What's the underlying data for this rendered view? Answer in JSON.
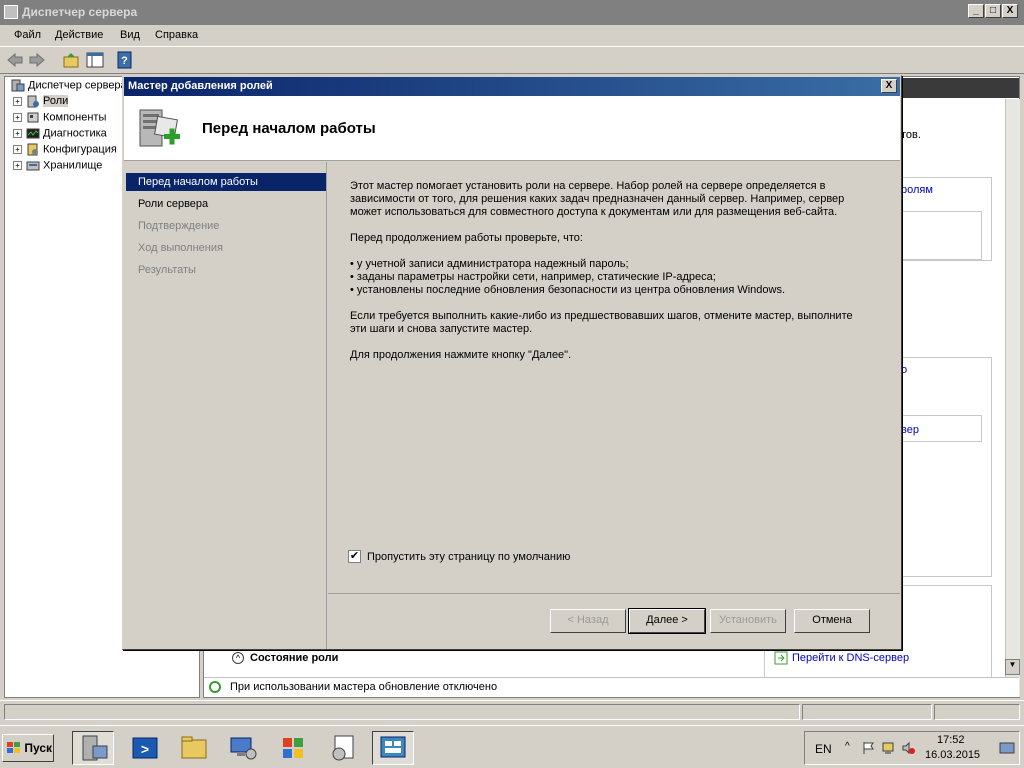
{
  "window": {
    "title": "Диспетчер сервера",
    "min": "_",
    "max": "□",
    "close": "X"
  },
  "menu": {
    "file": "Файл",
    "action": "Действие",
    "view": "Вид",
    "help": "Справка"
  },
  "tree": {
    "root": "Диспетчер сервера",
    "items": [
      "Роли",
      "Компоненты",
      "Диагностика",
      "Конфигурация",
      "Хранилище"
    ]
  },
  "background": {
    "frag1": "тов.",
    "frag2": "ролям",
    "frag3": "о",
    "frag4": "вер",
    "role_status": "Состояние роли",
    "dns_link": "Перейти к DNS-сервер",
    "status_text": "При использовании мастера обновление отключено"
  },
  "dialog": {
    "title": "Мастер добавления ролей",
    "heading": "Перед началом работы",
    "nav": [
      "Перед началом работы",
      "Роли сервера",
      "Подтверждение",
      "Ход выполнения",
      "Результаты"
    ],
    "para1": "Этот мастер помогает установить роли на сервере. Набор ролей на сервере определяется в зависимости от того, для решения каких задач предназначен данный сервер. Например, сервер может использоваться для совместного доступа к документам или для размещения веб-сайта.",
    "para2": "Перед продолжением работы проверьте, что:",
    "bullet1": "• у учетной записи администратора надежный пароль;",
    "bullet2": "• заданы параметры настройки сети, например, статические IP-адреса;",
    "bullet3": "• установлены последние обновления безопасности из центра обновления Windows.",
    "para3": "Если требуется выполнить какие-либо из предшествовавших шагов, отмените мастер, выполните эти шаги и снова запустите мастер.",
    "para4": "Для продолжения нажмите кнопку \"Далее\".",
    "skip_label": "Пропустить эту страницу по умолчанию",
    "skip_checked": "✔",
    "buttons": {
      "back": "< Назад",
      "next": "Далее >",
      "install": "Установить",
      "cancel": "Отмена"
    }
  },
  "taskbar": {
    "start": "Пуск",
    "lang": "EN",
    "time": "17:52",
    "date": "16.03.2015"
  },
  "colors": {
    "accent": "#0a246a",
    "titlebar_inactive": "#808080",
    "face": "#d4d0c8"
  }
}
